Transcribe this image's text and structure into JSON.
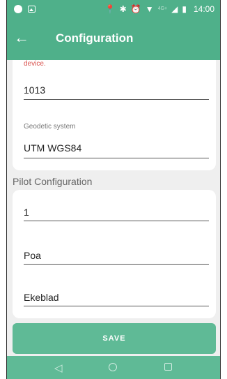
{
  "status_bar": {
    "icons": [
      "circle-dot-icon",
      "image-icon",
      "location-icon",
      "bluetooth-icon",
      "alarm-icon",
      "wifi-icon",
      "signal-icon",
      "battery-icon"
    ],
    "network_label": "4G+",
    "time": "14:00"
  },
  "app_bar": {
    "title": "Configuration"
  },
  "device_section": {
    "error_text": "device.",
    "device_id_value": "1013",
    "geodetic_label": "Geodetic system",
    "geodetic_value": "UTM WGS84"
  },
  "pilot_section": {
    "title": "Pilot Configuration",
    "field1_value": "1",
    "field2_value": "Poa",
    "field3_value": "Ekeblad"
  },
  "save_button": {
    "label": "SAVE"
  },
  "nav_bar": {
    "back": "◁"
  },
  "colors": {
    "primary": "#4fb08a",
    "button": "#5fba96",
    "error": "#d9534f",
    "background": "#efefef"
  }
}
